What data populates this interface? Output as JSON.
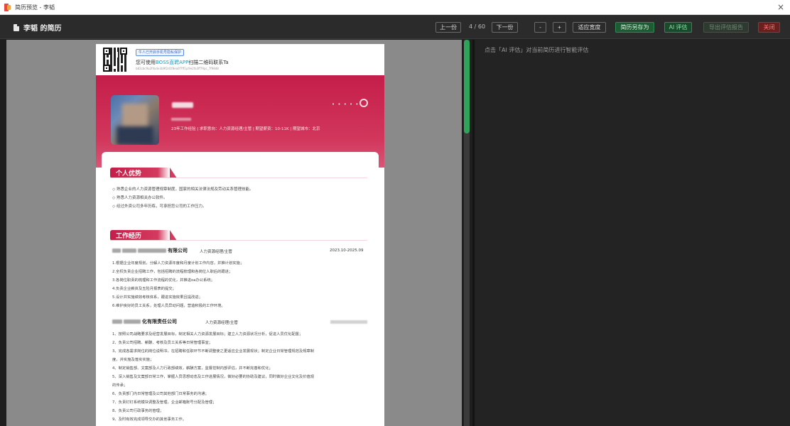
{
  "window": {
    "title": "简历预览 - 李韬",
    "close_glyph": "×"
  },
  "toolbar": {
    "doc_title": "李韬 的简历",
    "prev_label": "上一份",
    "page_indicator": "4 / 60",
    "next_label": "下一份",
    "zoom_out_label": "-",
    "zoom_in_label": "+",
    "fit_width_label": "适应宽度",
    "save_as_label": "简历另存为",
    "ai_eval_label": "AI 评估",
    "export_label": "导出评估报告",
    "close_label": "关闭"
  },
  "right_pane": {
    "hint": "点击「AI 评估」对当前简历进行智能评估"
  },
  "resume": {
    "qr": {
      "badge": "牛人已开启手机号隐私保护",
      "line_prefix": "您可使用",
      "line_brand": "BOSS直聘APP",
      "line_suffix": "扫描二维码联系Ta",
      "code": "b82cbc9a2f4a4e3b9f2d1f8ea0f7ff1jc9e2fa3ff79pc_7f98d8"
    },
    "summary": "23年工作经验 | 求职意向：人力资源经理/主管 | 期望薪资：10-11K | 期望城市：北京",
    "sections": {
      "advantages_title": "个人优势",
      "experience_title": "工作经历"
    },
    "advantages": [
      "◇ 熟悉企业的人力资源管理规章制度，国家的相关法律法规及劳动关系管理技能。",
      "◇ 熟悉人力资源相关办公软件。",
      "◇ 经过外资公司多年历练，可承担您公司的工作压力。"
    ],
    "job1": {
      "company_tail": "有限公司",
      "role": "人力资源经理/主管",
      "date": "2023.10-2025.09",
      "duties": [
        "1.根据企业年度规划，分解人力资源年度和月度计划工作内容，并推计划实施；",
        "2.全权负责企业招聘工作，包括招聘的流程梳理和各岗位人职后的跟进；",
        "3.各岗位职责的梳理和工作流程的优化，并推进oa办公系统；",
        "4.负责企业薪资及五险月报表的提交；",
        "5.设计并实施绩效考核体系，跟进实施效果且提改进；",
        "6.维护良好的员工关系，处理人员异动问题，营造积极的工作环境。"
      ]
    },
    "job2": {
      "company_tail": "化有限责任公司",
      "role": "人力资源经理/主管",
      "duties": [
        "1、按照公司战略要求及经营发展目标，制定相关人力资源发展目标；建立人力资源状况分析，促进人员优化配置；",
        "2、负责公司招聘、薪酬、考核及员工关系等日常管理事宜；",
        "3、完成各需求岗位的岗位说明书，在招聘和任职环节不断调整使之更适应企业发展现状；制定企业日常管理规范及规章制",
        "度，并实施及落实实施；",
        "4、制定销售部、文案部及人力行政部绩效，薪酬方案，监督控制内部评估，并不断完善和优化；",
        "5、深入销售及文案部日常工作，掌握人员思想动态及工作进展情况，做好必要的协助及建议，同时做好企业文化及价值观",
        "的传承；",
        "6、负责部门内日常管理及公司其他部门日常事务的沟通；",
        "7、负责钉钉系统模块调整及管理，企业邮箱账号分配及管理；",
        "8、负责公司行政事务的管理；",
        "9、及时有效完成领导交办的其他事务工作。"
      ]
    }
  }
}
